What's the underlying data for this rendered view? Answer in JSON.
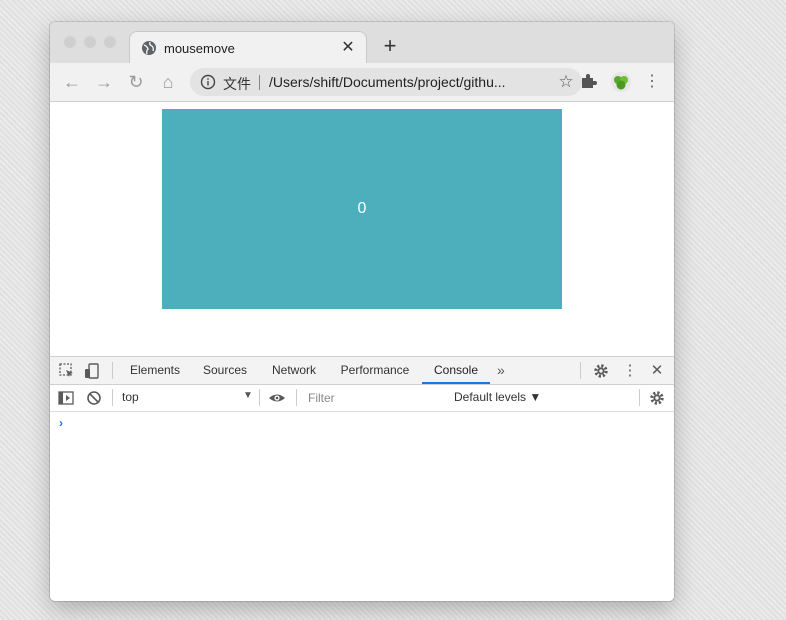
{
  "browser": {
    "tab": {
      "title": "mousemove",
      "close_glyph": "✕"
    },
    "new_tab_glyph": "+",
    "toolbar": {
      "back_glyph": "←",
      "forward_glyph": "→",
      "reload_glyph": "↻",
      "home_glyph": "⌂",
      "site_label": "文件",
      "url": "/Users/shift/Documents/project/githu...",
      "star_glyph": "☆",
      "menu_glyph": "⋮"
    }
  },
  "page": {
    "counter": "0",
    "box_color": "#4daebc"
  },
  "devtools": {
    "tabs": [
      {
        "label": "Elements"
      },
      {
        "label": "Sources"
      },
      {
        "label": "Network"
      },
      {
        "label": "Performance"
      },
      {
        "label": "Console"
      }
    ],
    "more_glyph": "»",
    "menu_glyph": "⋮",
    "close_glyph": "✕",
    "console": {
      "context": "top",
      "context_arrow": "▼",
      "filter_placeholder": "Filter",
      "levels": "Default levels ▼",
      "prompt": "›"
    },
    "accent": "#1a73e8"
  }
}
